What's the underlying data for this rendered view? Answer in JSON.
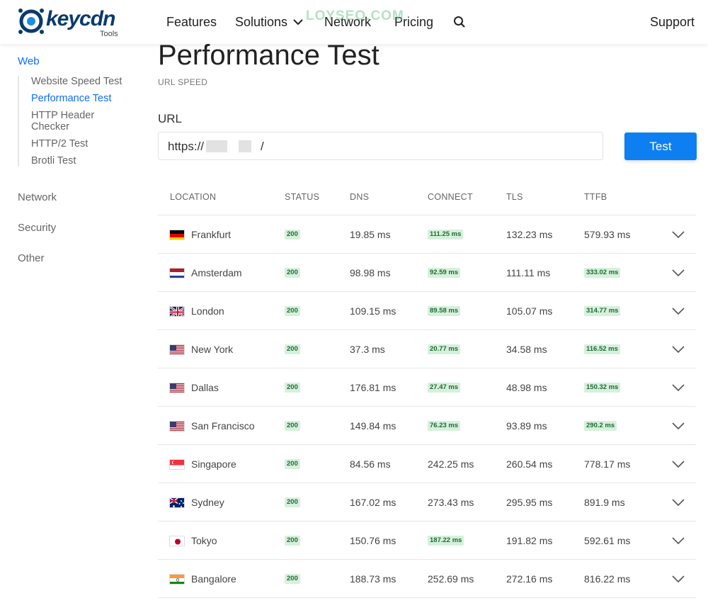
{
  "header": {
    "logo_text": "keycdn",
    "logo_sub": "Tools",
    "nav": {
      "features": "Features",
      "solutions": "Solutions",
      "network": "Network",
      "pricing": "Pricing",
      "support": "Support"
    },
    "watermark": "LOYSEO.COM"
  },
  "sidebar": {
    "web": "Web",
    "web_items": [
      "Website Speed Test",
      "Performance Test",
      "HTTP Header Checker",
      "HTTP/2 Test",
      "Brotli Test"
    ],
    "network": "Network",
    "security": "Security",
    "other": "Other"
  },
  "main": {
    "title": "Performance Test",
    "subtitle": "URL SPEED",
    "url_label": "URL",
    "url_prefix": "https://",
    "url_suffix": "/",
    "test_label": "Test"
  },
  "table": {
    "headers": [
      "LOCATION",
      "STATUS",
      "DNS",
      "CONNECT",
      "TLS",
      "TTFB"
    ],
    "rows": [
      {
        "location": "Frankfurt",
        "flag": "de",
        "status": "200",
        "dns": "19.85 ms",
        "connect": "111.25 ms",
        "connect_hl": true,
        "tls": "132.23 ms",
        "ttfb": "579.93 ms",
        "ttfb_hl": false
      },
      {
        "location": "Amsterdam",
        "flag": "nl",
        "status": "200",
        "dns": "98.98 ms",
        "connect": "92.59 ms",
        "connect_hl": true,
        "tls": "111.11 ms",
        "ttfb": "333.02 ms",
        "ttfb_hl": true
      },
      {
        "location": "London",
        "flag": "gb",
        "status": "200",
        "dns": "109.15 ms",
        "connect": "89.58 ms",
        "connect_hl": true,
        "tls": "105.07 ms",
        "ttfb": "314.77 ms",
        "ttfb_hl": true
      },
      {
        "location": "New York",
        "flag": "us",
        "status": "200",
        "dns": "37.3 ms",
        "connect": "20.77 ms",
        "connect_hl": true,
        "tls": "34.58 ms",
        "ttfb": "116.52 ms",
        "ttfb_hl": true
      },
      {
        "location": "Dallas",
        "flag": "us",
        "status": "200",
        "dns": "176.81 ms",
        "connect": "27.47 ms",
        "connect_hl": true,
        "tls": "48.98 ms",
        "ttfb": "150.32 ms",
        "ttfb_hl": true
      },
      {
        "location": "San Francisco",
        "flag": "us",
        "status": "200",
        "dns": "149.84 ms",
        "connect": "76.23 ms",
        "connect_hl": true,
        "tls": "93.89 ms",
        "ttfb": "290.2 ms",
        "ttfb_hl": true
      },
      {
        "location": "Singapore",
        "flag": "sg",
        "status": "200",
        "dns": "84.56 ms",
        "connect": "242.25 ms",
        "connect_hl": false,
        "tls": "260.54 ms",
        "ttfb": "778.17 ms",
        "ttfb_hl": false
      },
      {
        "location": "Sydney",
        "flag": "au",
        "status": "200",
        "dns": "167.02 ms",
        "connect": "273.43 ms",
        "connect_hl": false,
        "tls": "295.95 ms",
        "ttfb": "891.9 ms",
        "ttfb_hl": false
      },
      {
        "location": "Tokyo",
        "flag": "jp",
        "status": "200",
        "dns": "150.76 ms",
        "connect": "187.22 ms",
        "connect_hl": true,
        "tls": "191.82 ms",
        "ttfb": "592.61 ms",
        "ttfb_hl": false
      },
      {
        "location": "Bangalore",
        "flag": "in",
        "status": "200",
        "dns": "188.73 ms",
        "connect": "252.69 ms",
        "connect_hl": false,
        "tls": "272.16 ms",
        "ttfb": "816.22 ms",
        "ttfb_hl": false
      }
    ]
  },
  "colors": {
    "accent": "#0d7ff0",
    "link_active": "#0d6efd",
    "badge_bg": "#d6f0dc",
    "badge_text": "#1e6b33"
  }
}
